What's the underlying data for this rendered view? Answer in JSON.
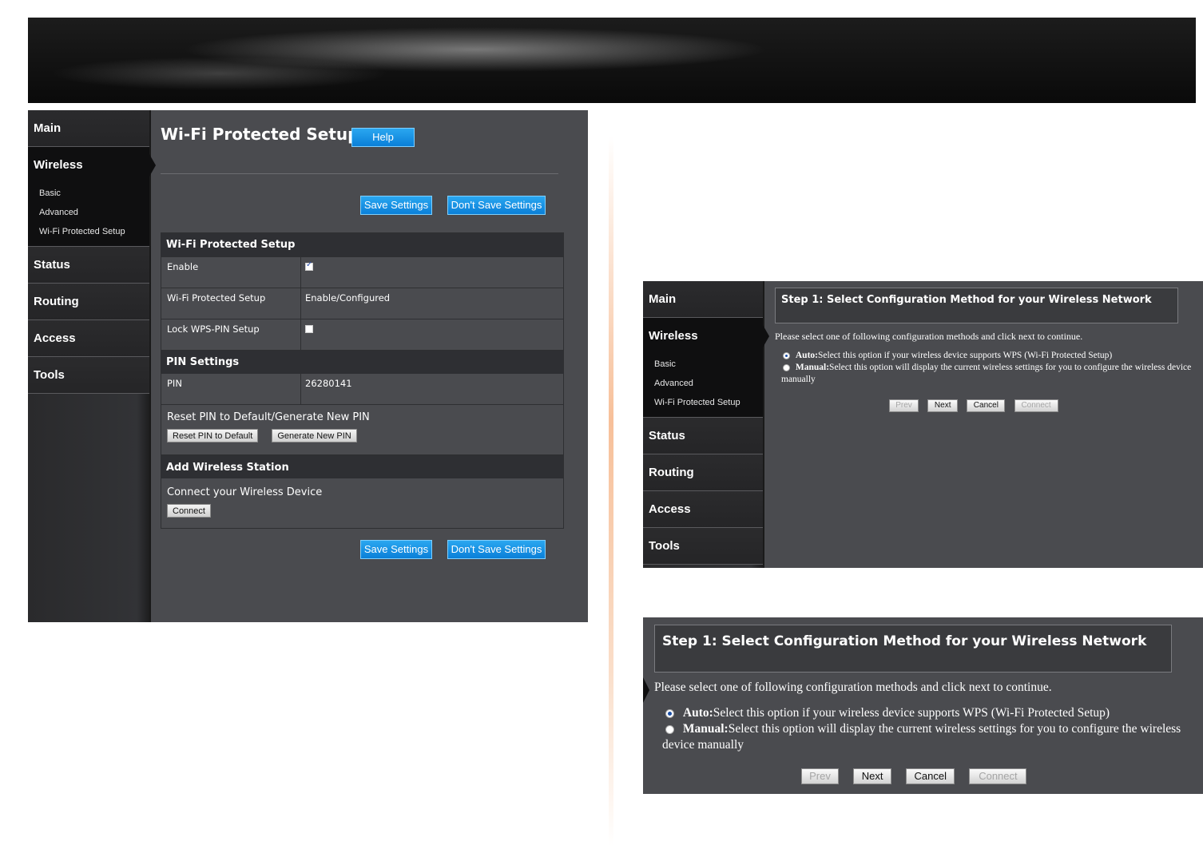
{
  "nav": {
    "main": "Main",
    "wireless": "Wireless",
    "wireless_sub": [
      "Basic",
      "Advanced",
      "Wi-Fi Protected Setup"
    ],
    "status": "Status",
    "routing": "Routing",
    "access": "Access",
    "tools": "Tools"
  },
  "wps_page": {
    "title": "Wi-Fi Protected Setup",
    "help_label": "Help",
    "save_label": "Save Settings",
    "dont_save_label": "Don't Save Settings",
    "section_wps": "Wi-Fi Protected Setup",
    "rows": [
      {
        "label": "Enable",
        "checked": true
      },
      {
        "label": "Wi-Fi Protected Setup",
        "value": "Enable/Configured"
      },
      {
        "label": "Lock WPS-PIN Setup",
        "checked": false
      }
    ],
    "section_pin": "PIN Settings",
    "pin_label": "PIN",
    "pin_value": "26280141",
    "reset_text": "Reset PIN to Default/Generate New PIN",
    "reset_btn": "Reset PIN to Default",
    "generate_btn": "Generate New PIN",
    "section_add": "Add Wireless Station",
    "connect_text": "Connect your Wireless Device",
    "connect_btn": "Connect"
  },
  "wizard": {
    "step_title": "Step 1: Select Configuration Method for your Wireless Network",
    "instruction": "Please select one of following configuration methods and click next to continue.",
    "auto_label": "Auto:",
    "auto_text": "Select this option if your wireless device supports WPS (Wi-Fi Protected Setup)",
    "manual_label": "Manual:",
    "manual_text": "Select this option will display the current wireless settings for you to configure the wireless device manually",
    "prev": "Prev",
    "next": "Next",
    "cancel": "Cancel",
    "connect": "Connect",
    "selected": "auto"
  },
  "colors": {
    "panel_bg": "#4a4b4f",
    "sidebar_active": "#0f0f10",
    "button_blue": "#0a7fd8"
  }
}
